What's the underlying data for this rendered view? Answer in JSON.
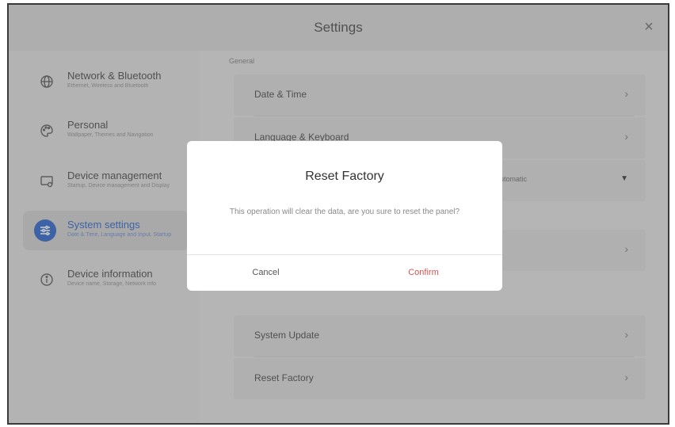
{
  "window": {
    "title": "Settings",
    "close_glyph": "×"
  },
  "sidebar": {
    "items": [
      {
        "label": "Network & Bluetooth",
        "sub": "Ethernet, Wireless and Bluetooth",
        "icon": "globe-icon",
        "active": false
      },
      {
        "label": "Personal",
        "sub": "Wallpaper, Themes and Navigation",
        "icon": "palette-icon",
        "active": false
      },
      {
        "label": "Device management",
        "sub": "Startup, Device management and Display",
        "icon": "device-icon",
        "active": false
      },
      {
        "label": "System settings",
        "sub": "Date & Time, Language and Input, Startup",
        "icon": "sliders-icon",
        "active": true
      },
      {
        "label": "Device information",
        "sub": "Device name, Storage, Network info",
        "icon": "info-icon",
        "active": false
      }
    ]
  },
  "content": {
    "section_general": "General",
    "rows": {
      "date_time": "Date & Time",
      "language_keyboard": "Language & Keyboard",
      "dropdown_value": "Automatic",
      "system_update": "System Update",
      "reset_factory": "Reset Factory"
    },
    "chevron": "›",
    "dropdown_arrow": "▼"
  },
  "dialog": {
    "title": "Reset Factory",
    "message": "This operation will clear the data, are you sure to reset the panel?",
    "cancel_label": "Cancel",
    "confirm_label": "Confirm"
  },
  "colors": {
    "accent": "#3b6fd0",
    "confirm": "#d9534f"
  }
}
